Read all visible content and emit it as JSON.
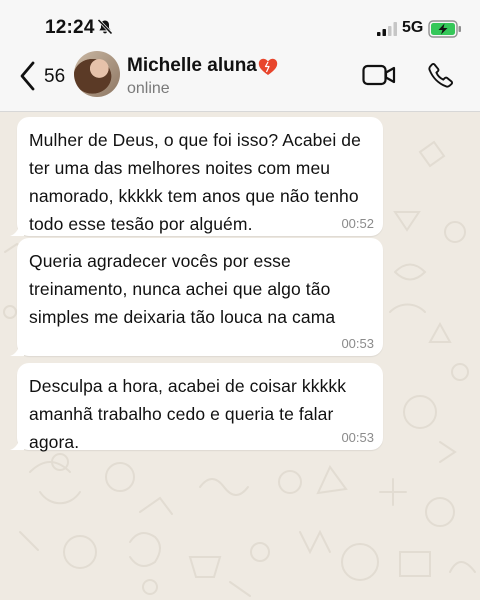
{
  "status_bar": {
    "time": "12:24",
    "network": "5G"
  },
  "header": {
    "back_count": "56",
    "contact_name": "Michelle aluna",
    "contact_status": "online",
    "icons": [
      "chevron-left-icon",
      "heart-icon",
      "video-call-icon",
      "phone-call-icon"
    ]
  },
  "messages": [
    {
      "text": "Mulher de Deus, o que foi isso? Acabei de ter uma das melhores noites com meu namorado, kkkkk tem anos que não tenho todo esse tesão por alguém.",
      "time": "00:52"
    },
    {
      "text": "Queria agradecer vocês por esse treinamento, nunca achei que algo tão simples me deixaria tão louca na cama",
      "time": "00:53"
    },
    {
      "text": "Desculpa a hora, acabei de coisar kkkkk amanhã trabalho cedo e queria te falar agora.",
      "time": "00:53"
    }
  ],
  "colors": {
    "chat_background": "#efeae2",
    "bubble": "#ffffff",
    "battery": "#35c759",
    "heart": "#e8452c"
  }
}
